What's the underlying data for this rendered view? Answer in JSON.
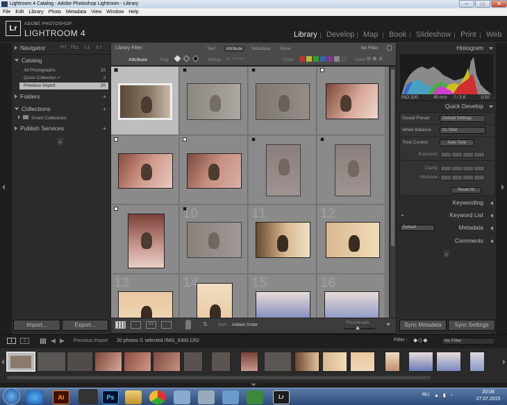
{
  "window": {
    "title": "Lightroom 4 Catalog - Adobe Photoshop Lightroom - Library"
  },
  "menu": [
    "File",
    "Edit",
    "Library",
    "Photo",
    "Metadata",
    "View",
    "Window",
    "Help"
  ],
  "brand": {
    "logo": "Lr",
    "line1": "ADOBE PHOTOSHOP",
    "line2": "LIGHTROOM 4"
  },
  "modules": [
    "Library",
    "Develop",
    "Map",
    "Book",
    "Slideshow",
    "Print",
    "Web"
  ],
  "left": {
    "navigator": {
      "title": "Navigator",
      "opts": [
        "FIT",
        "FILL",
        "1:1",
        "3:1"
      ]
    },
    "catalog": {
      "title": "Catalog",
      "items": [
        {
          "label": "All Photographs",
          "count": "25"
        },
        {
          "label": "Quick Collection +",
          "count": "3"
        },
        {
          "label": "Previous Import",
          "count": "20"
        }
      ]
    },
    "folders": "Folders",
    "collections": {
      "title": "Collections",
      "smart": "Smart Collections"
    },
    "publish": "Publish Services",
    "import_btn": "Import...",
    "export_btn": "Export..."
  },
  "filter": {
    "label": "Library Filter :",
    "tabs": [
      "Text",
      "Attribute",
      "Metadata",
      "None"
    ],
    "preset": "No Filter",
    "attribute": "Attribute",
    "flag": "Flag",
    "rating": "Rating",
    "color": "Color",
    "kind": "Kind"
  },
  "grid": {
    "numbers": [
      "13",
      "14",
      "15",
      "16",
      "10",
      "11",
      "12"
    ]
  },
  "toolbar": {
    "sort_label": "Sort:",
    "sort_value": "Added Order",
    "thumbs_label": "Thumbnails"
  },
  "right": {
    "histogram": {
      "title": "Histogram",
      "iso": "ISO 320",
      "focal": "45 mm",
      "aperture": "f / 2.8",
      "shutter": "1/10"
    },
    "quick_develop": {
      "title": "Quick Develop",
      "saved_preset_label": "Saved Preset",
      "saved_preset_value": "Default Settings",
      "wb_label": "White Balance",
      "wb_value": "As Shot",
      "tone_label": "Tone Control",
      "auto_tone": "Auto Tone",
      "exposure": "Exposure",
      "clarity": "Clarity",
      "vibrance": "Vibrance",
      "reset": "Reset All"
    },
    "keywording": "Keywording",
    "keyword_list": "Keyword List",
    "metadata": {
      "title": "Metadata",
      "value": "Default"
    },
    "comments": "Comments",
    "sync_meta": "Sync Metadata",
    "sync_settings": "Sync Settings"
  },
  "filmstrip": {
    "source": "Previous Import",
    "summary": "20 photos /1 selected /IMG_9300.CR2",
    "filter_label": "Filter :",
    "filter_value": "No Filter",
    "pages": [
      "1",
      "2"
    ]
  },
  "taskbar": {
    "lang": "RU",
    "time": "20:08",
    "date": "27.07.2015"
  },
  "colors": {
    "accent": "#e6e6e6",
    "panel": "#2b2b2b",
    "grid": "#8a8a8a",
    "selected": "#bdbdbd"
  }
}
